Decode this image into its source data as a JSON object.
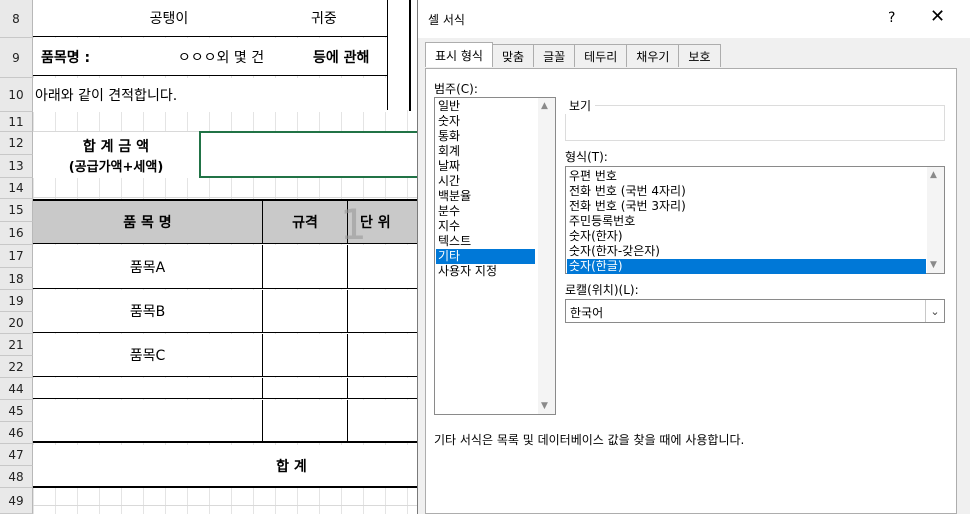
{
  "sheet": {
    "rows": [
      "8",
      "9",
      "10",
      "11",
      "12",
      "13",
      "14",
      "15",
      "16",
      "17",
      "18",
      "19",
      "20",
      "21",
      "22",
      "44",
      "45",
      "46",
      "47",
      "48",
      "49"
    ],
    "recipient": "공탱이",
    "honorific": "귀중",
    "item_label": "품목명 :",
    "item_value": "ㅇㅇㅇ외 몇 건",
    "regarding": "등에 관해",
    "intro_text": "아래와 같이 견적합니다.",
    "total_label_1": "합 계 금 액",
    "total_label_2": "(공급가액+세액)",
    "col_item": "품 목 명",
    "col_spec": "규격",
    "col_unit": "단 위",
    "watermark": "1",
    "items": [
      "품목A",
      "품목B",
      "품목C"
    ],
    "sum_label": "합 계"
  },
  "dialog": {
    "title": "셀 서식",
    "help": "?",
    "close": "✕",
    "tabs": [
      "표시 형식",
      "맞춤",
      "글꼴",
      "테두리",
      "채우기",
      "보호"
    ],
    "category_label": "범주(C):",
    "categories": [
      "일반",
      "숫자",
      "통화",
      "회계",
      "날짜",
      "시간",
      "백분율",
      "분수",
      "지수",
      "텍스트",
      "기타",
      "사용자 지정"
    ],
    "selected_category": "기타",
    "preview_label": "보기",
    "type_label": "형식(T):",
    "types": [
      "우편 번호",
      "전화 번호 (국번 4자리)",
      "전화 번호 (국번 3자리)",
      "주민등록번호",
      "숫자(한자)",
      "숫자(한자-갖은자)",
      "숫자(한글)"
    ],
    "selected_type": "숫자(한글)",
    "locale_label": "로캘(위치)(L):",
    "locale_value": "한국어",
    "description": "기타 서식은 목록 및 데이터베이스 값을 찾을 때에 사용합니다."
  }
}
